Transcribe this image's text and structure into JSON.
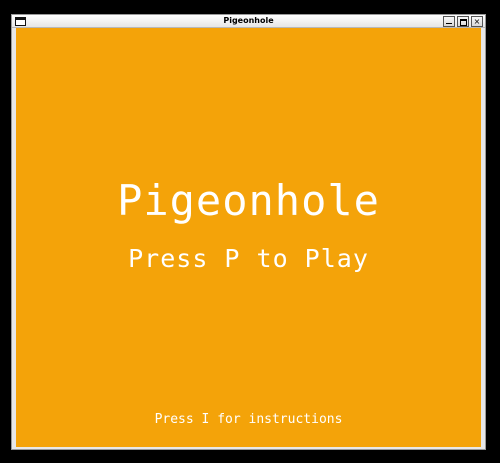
{
  "window": {
    "title": "Pigeonhole",
    "minimize_symbol": "",
    "maximize_symbol": "",
    "close_symbol": "×"
  },
  "game": {
    "title": "Pigeonhole",
    "play_prompt": "Press P to Play",
    "instructions_prompt": "Press I for instructions",
    "background_color": "#f4a309",
    "text_color": "#ffffff"
  }
}
